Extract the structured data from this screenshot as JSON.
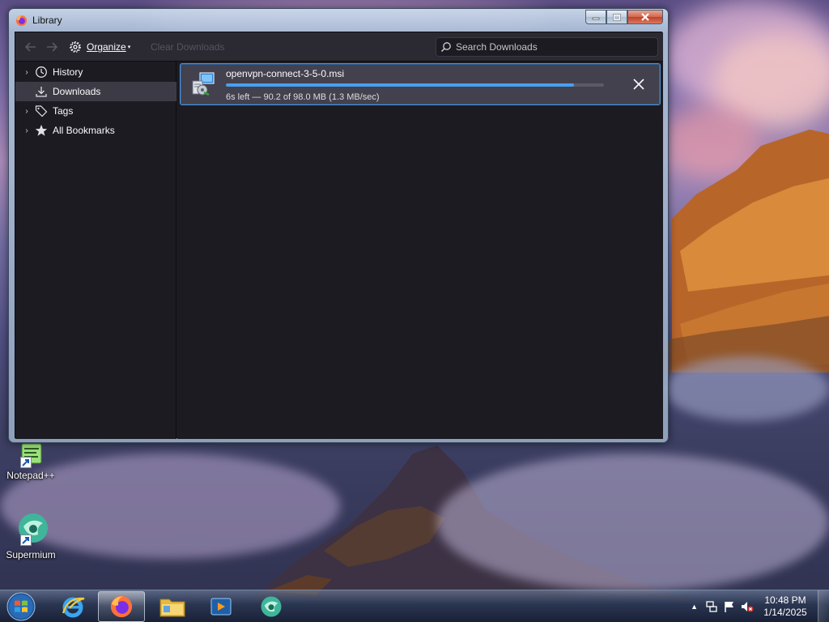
{
  "window": {
    "title": "Library"
  },
  "toolbar": {
    "organize_label": "Organize",
    "clear_downloads_label": "Clear Downloads",
    "search_placeholder": "Search Downloads"
  },
  "sidebar": {
    "items": [
      {
        "label": "History",
        "icon": "clock-icon",
        "expandable": true,
        "selected": false
      },
      {
        "label": "Downloads",
        "icon": "download-icon",
        "expandable": false,
        "selected": true
      },
      {
        "label": "Tags",
        "icon": "tag-icon",
        "expandable": true,
        "selected": false
      },
      {
        "label": "All Bookmarks",
        "icon": "star-icon",
        "expandable": true,
        "selected": false
      }
    ]
  },
  "downloads": [
    {
      "filename": "openvpn-connect-3-5-0.msi",
      "status": "6s left — 90.2 of 98.0 MB (1.3 MB/sec)",
      "progress_percent": 92,
      "icon": "msi-installer-icon"
    }
  ],
  "desktop_icons": [
    {
      "label": "Notepad++",
      "icon": "notepad-plus-plus-icon"
    },
    {
      "label": "Supermium",
      "icon": "supermium-icon"
    }
  ],
  "taskbar": {
    "apps": [
      {
        "name": "Internet Explorer",
        "icon": "internet-explorer-icon",
        "active": false
      },
      {
        "name": "Firefox",
        "icon": "firefox-icon",
        "active": true
      },
      {
        "name": "File Explorer",
        "icon": "folder-icon",
        "active": false
      },
      {
        "name": "Media Player",
        "icon": "media-player-icon",
        "active": false
      },
      {
        "name": "Supermium",
        "icon": "supermium-icon",
        "active": false
      }
    ],
    "clock": {
      "time": "10:48 PM",
      "date": "1/14/2025"
    }
  },
  "colors": {
    "accent": "#4a9ff0",
    "window_bg": "#1c1b22",
    "toolbar_bg": "#2b2a33",
    "selected_bg": "#3c3b45"
  }
}
